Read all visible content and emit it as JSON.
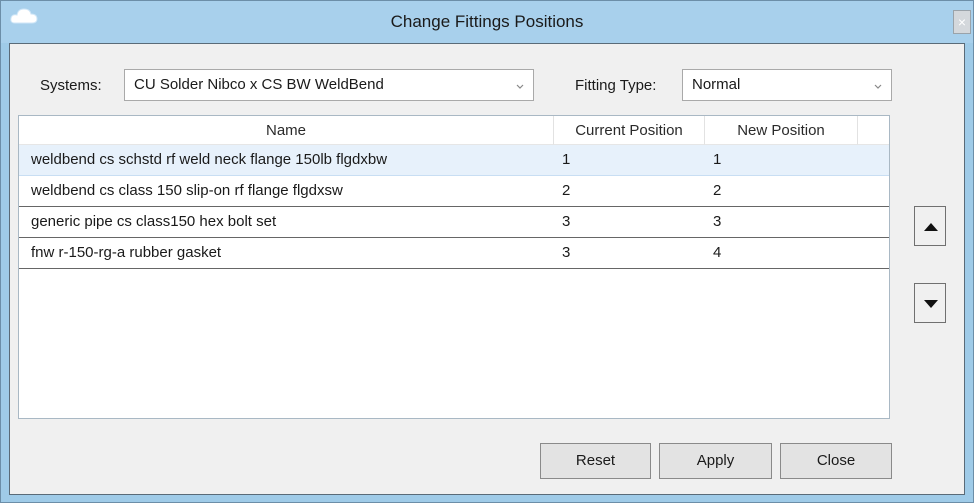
{
  "window": {
    "title": "Change Fittings Positions"
  },
  "filters": {
    "systems_label": "Systems:",
    "systems_value": "CU Solder Nibco x CS BW WeldBend",
    "fitting_type_label": "Fitting Type:",
    "fitting_type_value": "Normal"
  },
  "table": {
    "columns": [
      "Name",
      "Current Position",
      "New Position"
    ],
    "rows": [
      {
        "name": "weldbend cs schstd rf weld neck flange 150lb flgdxbw",
        "current": "1",
        "new": "1"
      },
      {
        "name": "weldbend cs class 150 slip-on rf flange flgdxsw",
        "current": "2",
        "new": "2"
      },
      {
        "name": "generic pipe cs class150 hex bolt set",
        "current": "3",
        "new": "3"
      },
      {
        "name": "fnw r-150-rg-a rubber gasket",
        "current": "3",
        "new": "4"
      }
    ]
  },
  "buttons": {
    "reset": "Reset",
    "apply": "Apply",
    "close": "Close"
  },
  "icons": {
    "app": "cloud-icon",
    "close": "close-icon",
    "move_up": "arrow-up-icon",
    "move_down": "arrow-down-icon"
  }
}
